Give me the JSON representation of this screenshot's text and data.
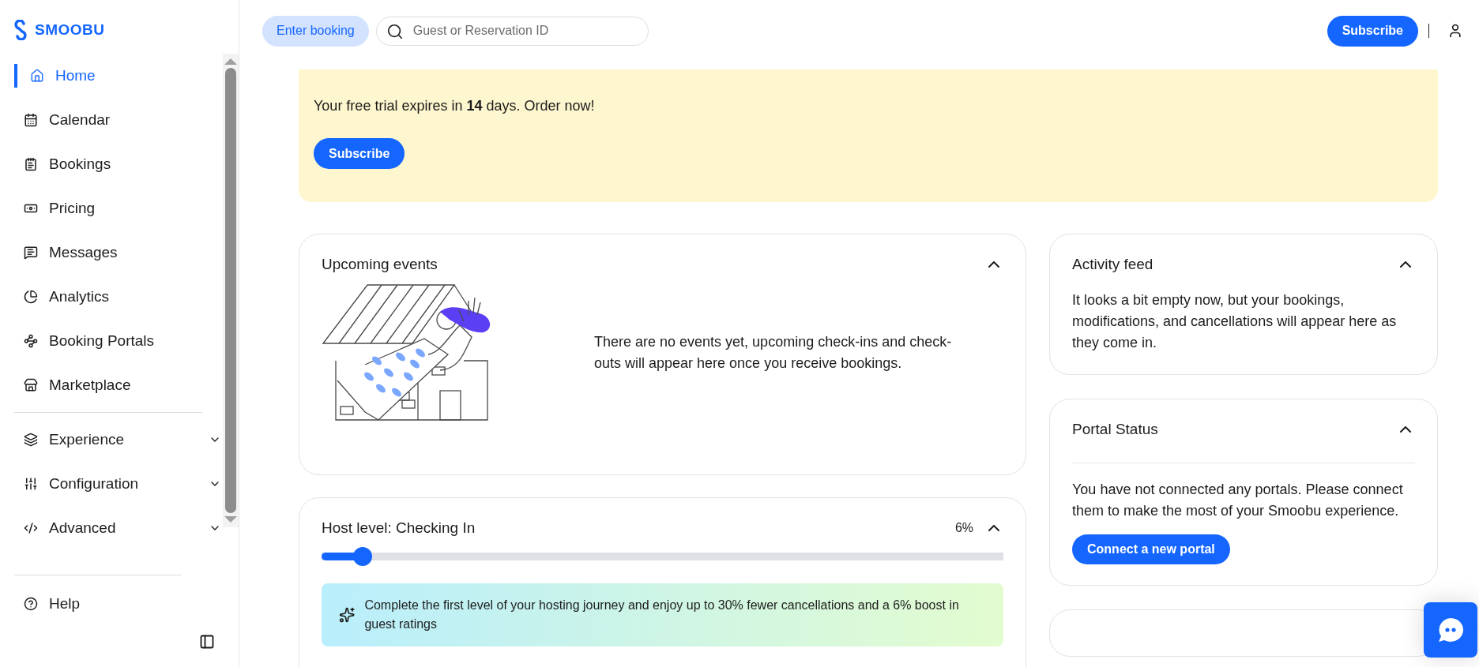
{
  "brand": {
    "name": "SMOOBU"
  },
  "sidebar": {
    "items": [
      {
        "label": "Home",
        "kind": "link",
        "selected": true
      },
      {
        "label": "Calendar",
        "kind": "link",
        "selected": false
      },
      {
        "label": "Bookings",
        "kind": "link",
        "selected": false
      },
      {
        "label": "Pricing",
        "kind": "link",
        "selected": false
      },
      {
        "label": "Messages",
        "kind": "link",
        "selected": false
      },
      {
        "label": "Analytics",
        "kind": "link",
        "selected": false
      },
      {
        "label": "Booking Portals",
        "kind": "link",
        "selected": false
      },
      {
        "label": "Marketplace",
        "kind": "link",
        "selected": false
      },
      {
        "label": "Experience",
        "kind": "group",
        "selected": false,
        "expanded": false
      },
      {
        "label": "Configuration",
        "kind": "group",
        "selected": false,
        "expanded": false
      },
      {
        "label": "Advanced",
        "kind": "group",
        "selected": false,
        "expanded": false
      }
    ],
    "footer_items": [
      {
        "label": "Help"
      }
    ]
  },
  "topbar": {
    "enter_booking": "Enter booking",
    "search": {
      "placeholder": "Guest or Reservation ID"
    },
    "subscribe": "Subscribe"
  },
  "banner": {
    "text": "Your free trial expires in **14** days. Order now!",
    "button": "Subscribe"
  },
  "upcoming_events": {
    "title": "Upcoming events",
    "expanded": true,
    "text": "There are no events yet, upcoming check-ins and check-outs will appear here once you receive bookings."
  },
  "host_level": {
    "title": "Host level: Checking In",
    "percent": "6%",
    "expanded": true,
    "level": 0.06,
    "tip": "Complete the first level of your hosting journey and enjoy up to 30% fewer cancellations and a 6% boost in guest ratings"
  },
  "activity_feed": {
    "title": "Activity feed",
    "expanded": true,
    "text": "It looks a bit empty now, but your bookings, modifications, and cancellations will appear here as they come in."
  },
  "portal_status": {
    "title": "Portal Status",
    "expanded": true,
    "text": "You have not connected any portals. Please connect them to make the most of your Smoobu experience.",
    "button": "Connect a new portal"
  }
}
